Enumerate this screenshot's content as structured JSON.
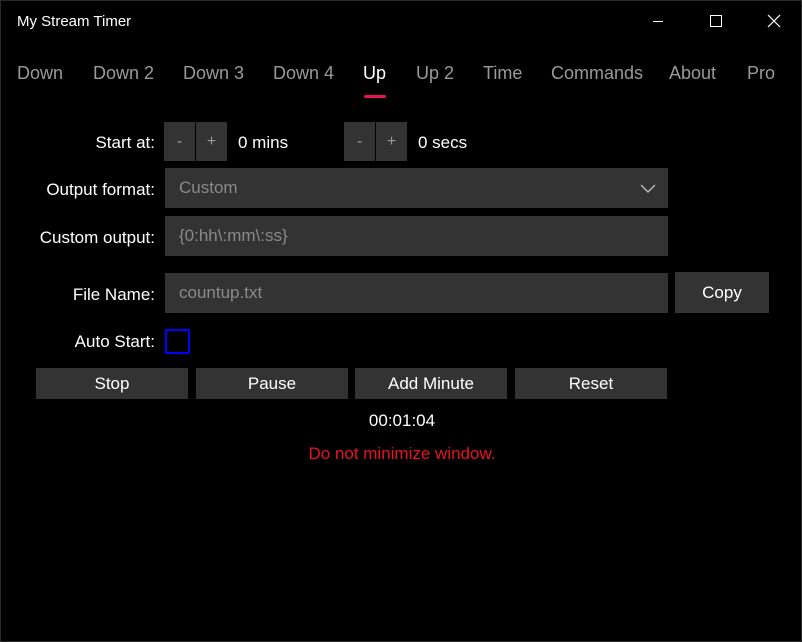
{
  "window": {
    "title": "My Stream Timer",
    "controls": [
      "minimize-icon",
      "maximize-icon",
      "close-icon"
    ]
  },
  "tabs": [
    {
      "label": "Down",
      "active": false
    },
    {
      "label": "Down 2",
      "active": false
    },
    {
      "label": "Down 3",
      "active": false
    },
    {
      "label": "Down 4",
      "active": false
    },
    {
      "label": "Up",
      "active": true
    },
    {
      "label": "Up 2",
      "active": false
    },
    {
      "label": "Time",
      "active": false
    },
    {
      "label": "Commands",
      "active": false
    },
    {
      "label": "About",
      "active": false
    },
    {
      "label": "Pro",
      "active": false
    }
  ],
  "form": {
    "start_at_label": "Start at:",
    "minus": "-",
    "plus": "+",
    "mins_value": "0 mins",
    "secs_value": "0 secs",
    "output_format_label": "Output format:",
    "output_format_value": "Custom",
    "custom_output_label": "Custom output:",
    "custom_output_value": "{0:hh\\:mm\\:ss}",
    "file_name_label": "File Name:",
    "file_name_value": "countup.txt",
    "copy_label": "Copy",
    "auto_start_label": "Auto Start:",
    "auto_start_checked": false
  },
  "actions": {
    "stop": "Stop",
    "pause": "Pause",
    "add_minute": "Add Minute",
    "reset": "Reset"
  },
  "timer": {
    "display": "00:01:04",
    "warning": "Do not minimize window."
  },
  "colors": {
    "accent": "#e81155",
    "warning": "#e81123",
    "checkbox_border": "#0000ff",
    "control_bg": "#333333"
  }
}
